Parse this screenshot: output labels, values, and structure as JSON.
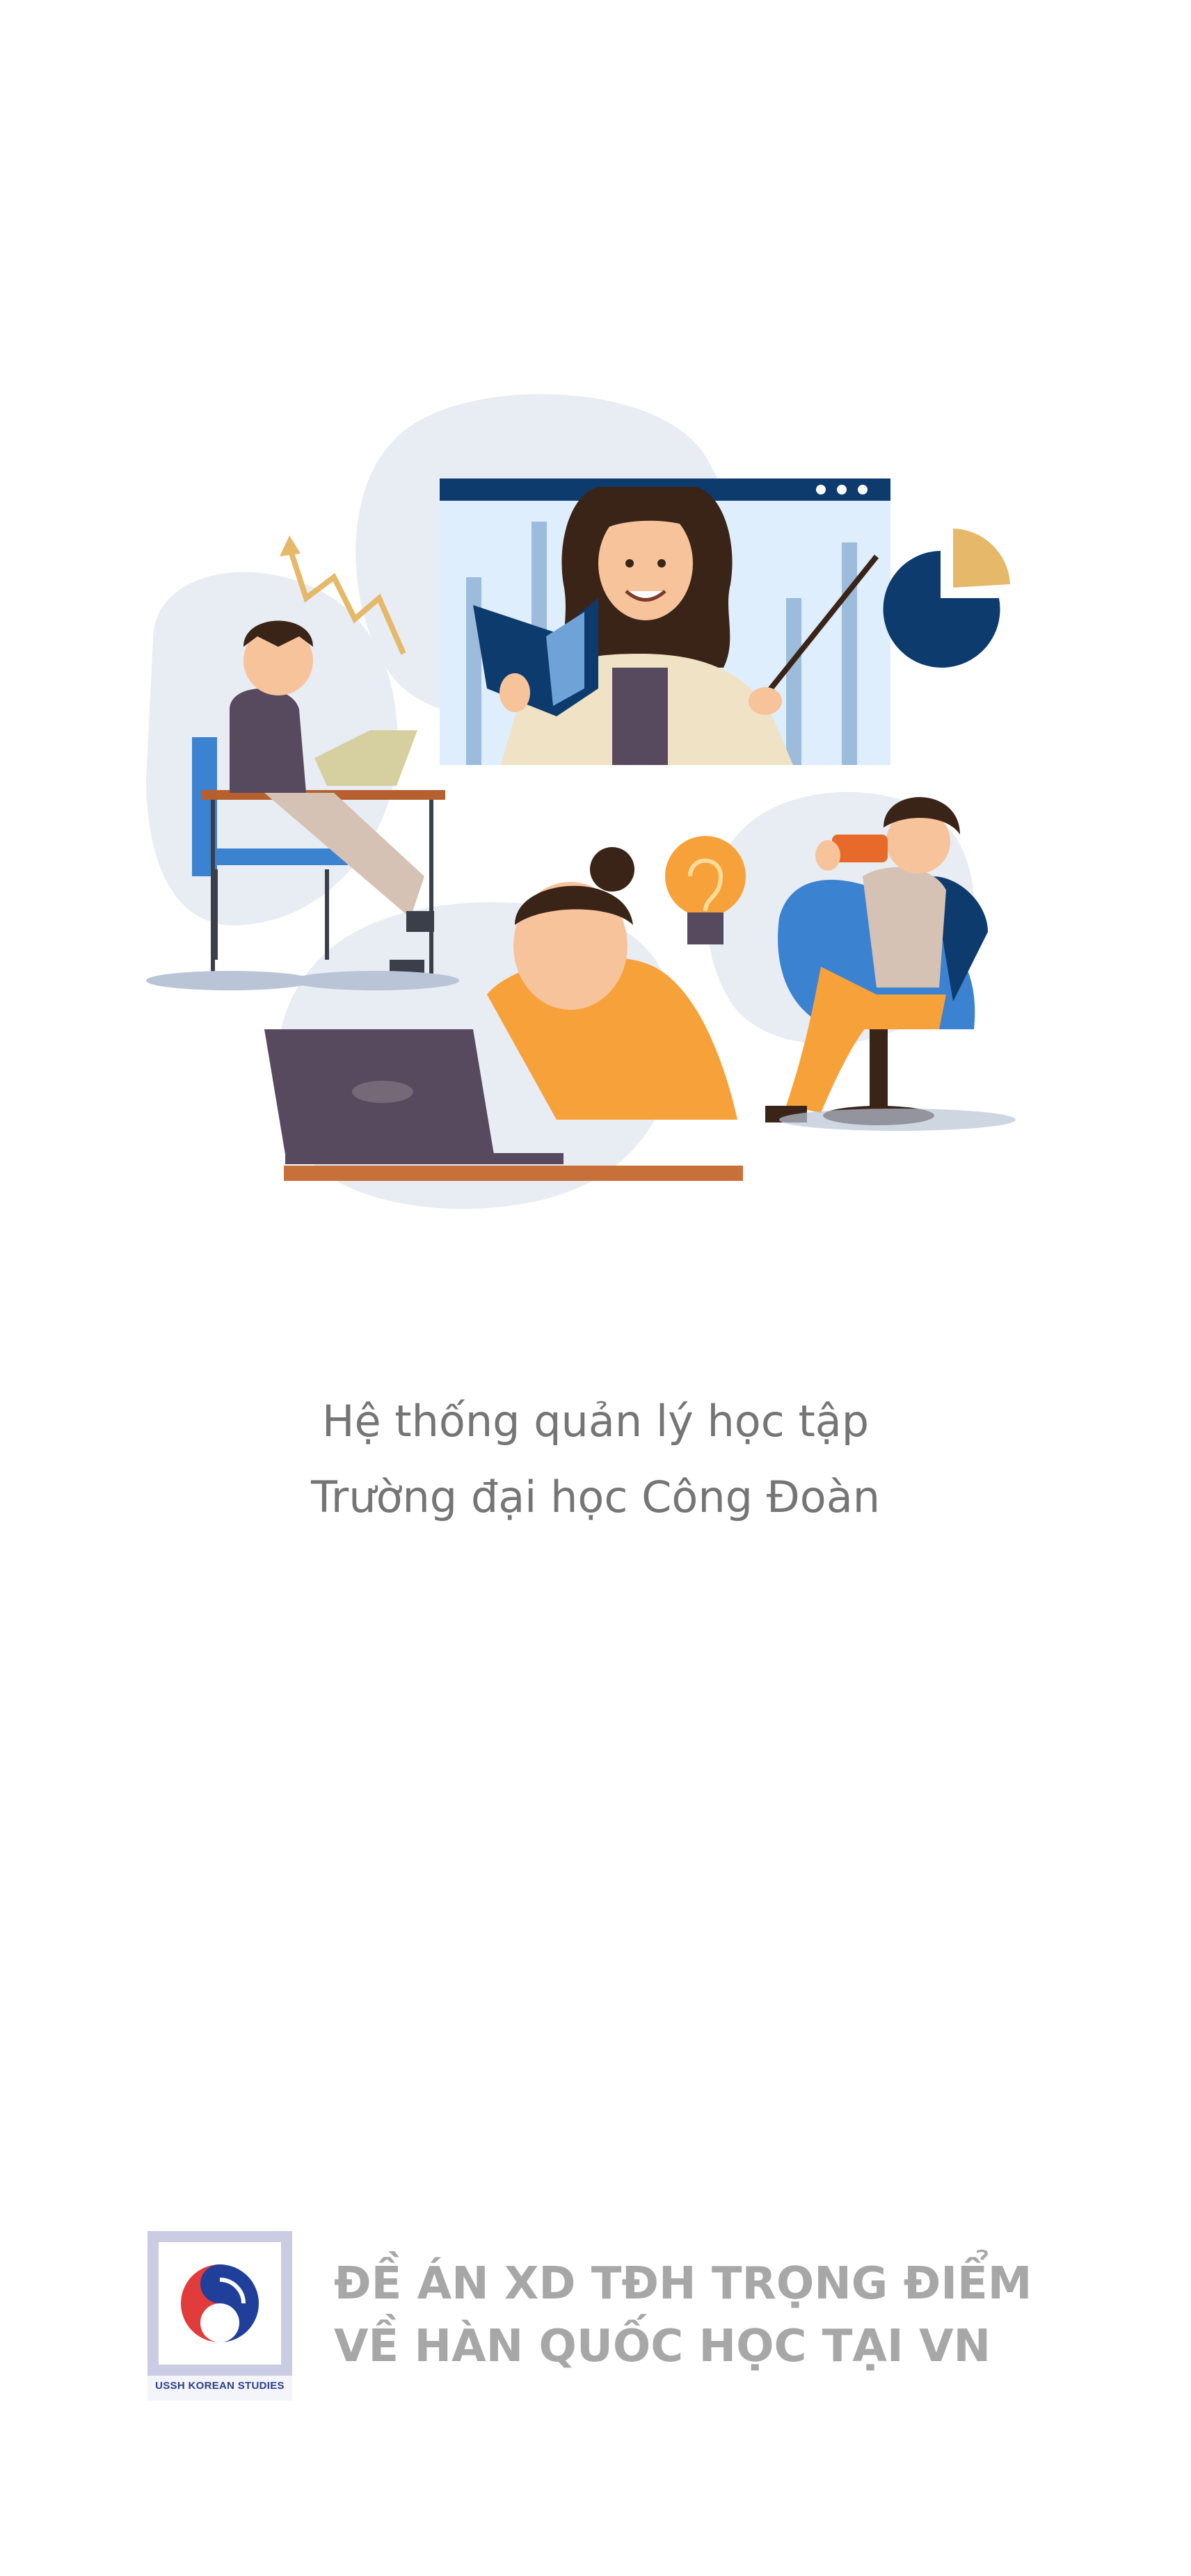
{
  "app": {
    "subtitle_line1": "Hệ thống quản lý học tập",
    "subtitle_line2": "Trường đại học Công Đoàn"
  },
  "illustration": {
    "icon": "online-learning-illustration"
  },
  "footer": {
    "logo_icon": "ussh-korean-studies-logo",
    "logo_caption": "USSH KOREAN STUDIES",
    "project_line1": "ĐỀ ÁN XD TĐH TRỌNG ĐIỂM",
    "project_line2": "VỀ HÀN QUỐC HỌC TẠI VN"
  },
  "colors": {
    "background": "#ffffff",
    "text_gray": "#757575",
    "footer_gray": "#a7a7a7",
    "navy": "#0d3b6e",
    "orange": "#f7a13a",
    "blue": "#3b82d0",
    "blob": "#e8ecf3"
  }
}
